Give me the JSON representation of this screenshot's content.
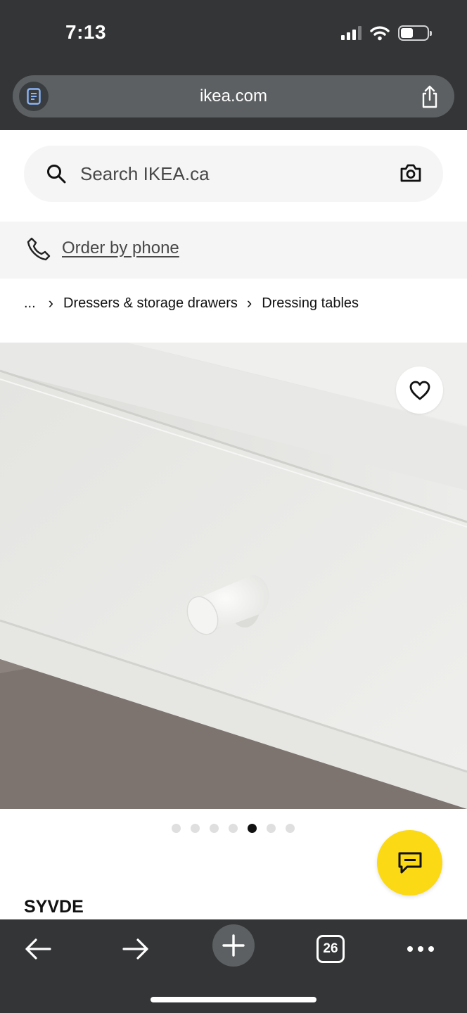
{
  "status_bar": {
    "time": "7:13"
  },
  "browser": {
    "url": "ikea.com",
    "tab_count": "26"
  },
  "search": {
    "placeholder": "Search IKEA.ca"
  },
  "phone": {
    "label": "Order by phone"
  },
  "breadcrumb": {
    "ellipsis": "...",
    "items": [
      "Dressers & storage drawers",
      "Dressing tables"
    ]
  },
  "carousel": {
    "total": 7,
    "active_index": 4
  },
  "product": {
    "name": "SYVDE"
  },
  "colors": {
    "chrome": "#333536",
    "chat_button": "#fbd914",
    "search_bg": "#f5f5f5"
  },
  "icons": [
    "reader-icon",
    "share-icon",
    "search-icon",
    "camera-icon",
    "phone-icon",
    "heart-icon",
    "chat-icon",
    "back-arrow-icon",
    "forward-arrow-icon",
    "plus-icon",
    "more-icon"
  ]
}
